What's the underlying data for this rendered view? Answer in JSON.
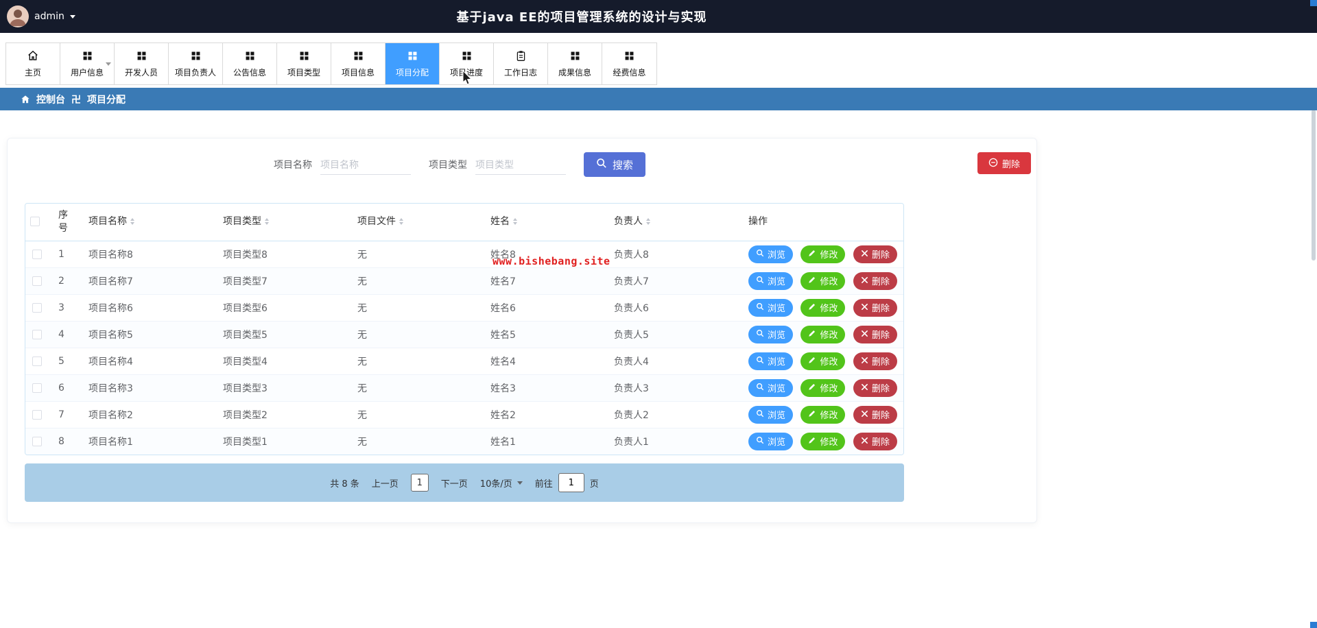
{
  "colors": {
    "header-bg": "#151b2b",
    "nav-active": "#409eff",
    "breadcrumb-bg": "#3a7ab5",
    "search-btn": "#5570d6",
    "delete-btn": "#d9373e",
    "pill-view": "#409eff",
    "pill-edit": "#52c41a",
    "pill-delete": "#bc3c46",
    "pagination-bg": "#a9cde7",
    "table-border": "#cde5f6",
    "watermark": "#e01f1f"
  },
  "header": {
    "username": "admin",
    "title": "基于java EE的项目管理系统的设计与实现"
  },
  "nav": {
    "active_index": 7,
    "tabs": [
      {
        "label": "主页",
        "icon": "home-icon"
      },
      {
        "label": "用户信息",
        "icon": "grid-icon",
        "caret": true
      },
      {
        "label": "开发人员",
        "icon": "grid-icon"
      },
      {
        "label": "项目负责人",
        "icon": "grid-icon"
      },
      {
        "label": "公告信息",
        "icon": "grid-icon"
      },
      {
        "label": "项目类型",
        "icon": "grid-icon"
      },
      {
        "label": "项目信息",
        "icon": "grid-icon"
      },
      {
        "label": "项目分配",
        "icon": "grid-icon"
      },
      {
        "label": "项目进度",
        "icon": "grid-icon"
      },
      {
        "label": "工作日志",
        "icon": "journal-icon"
      },
      {
        "label": "成果信息",
        "icon": "grid-icon"
      },
      {
        "label": "经费信息",
        "icon": "grid-icon"
      }
    ]
  },
  "breadcrumb": {
    "home": "控制台",
    "separator": "卍",
    "current": "项目分配"
  },
  "toolbar": {
    "name_label": "项目名称",
    "name_placeholder": "项目名称",
    "type_label": "项目类型",
    "type_placeholder": "项目类型",
    "search_label": "搜索",
    "delete_label": "删除"
  },
  "table": {
    "headers": [
      "序号",
      "项目名称",
      "项目类型",
      "项目文件",
      "姓名",
      "负责人",
      "操作"
    ],
    "actions": {
      "view": "浏览",
      "edit": "修改",
      "delete": "删除"
    },
    "rows": [
      {
        "no": "1",
        "name": "项目名称8",
        "type": "项目类型8",
        "file": "无",
        "person": "姓名8",
        "leader": "负责人8"
      },
      {
        "no": "2",
        "name": "项目名称7",
        "type": "项目类型7",
        "file": "无",
        "person": "姓名7",
        "leader": "负责人7"
      },
      {
        "no": "3",
        "name": "项目名称6",
        "type": "项目类型6",
        "file": "无",
        "person": "姓名6",
        "leader": "负责人6"
      },
      {
        "no": "4",
        "name": "项目名称5",
        "type": "项目类型5",
        "file": "无",
        "person": "姓名5",
        "leader": "负责人5"
      },
      {
        "no": "5",
        "name": "项目名称4",
        "type": "项目类型4",
        "file": "无",
        "person": "姓名4",
        "leader": "负责人4"
      },
      {
        "no": "6",
        "name": "项目名称3",
        "type": "项目类型3",
        "file": "无",
        "person": "姓名3",
        "leader": "负责人3"
      },
      {
        "no": "7",
        "name": "项目名称2",
        "type": "项目类型2",
        "file": "无",
        "person": "姓名2",
        "leader": "负责人2"
      },
      {
        "no": "8",
        "name": "项目名称1",
        "type": "项目类型1",
        "file": "无",
        "person": "姓名1",
        "leader": "负责人1"
      }
    ]
  },
  "watermark": "www.bishebang.site",
  "pagination": {
    "total": "共 8 条",
    "prev": "上一页",
    "current_page": "1",
    "next": "下一页",
    "page_size": "10条/页",
    "goto_label": "前往",
    "goto_value": "1",
    "goto_suffix": "页"
  }
}
